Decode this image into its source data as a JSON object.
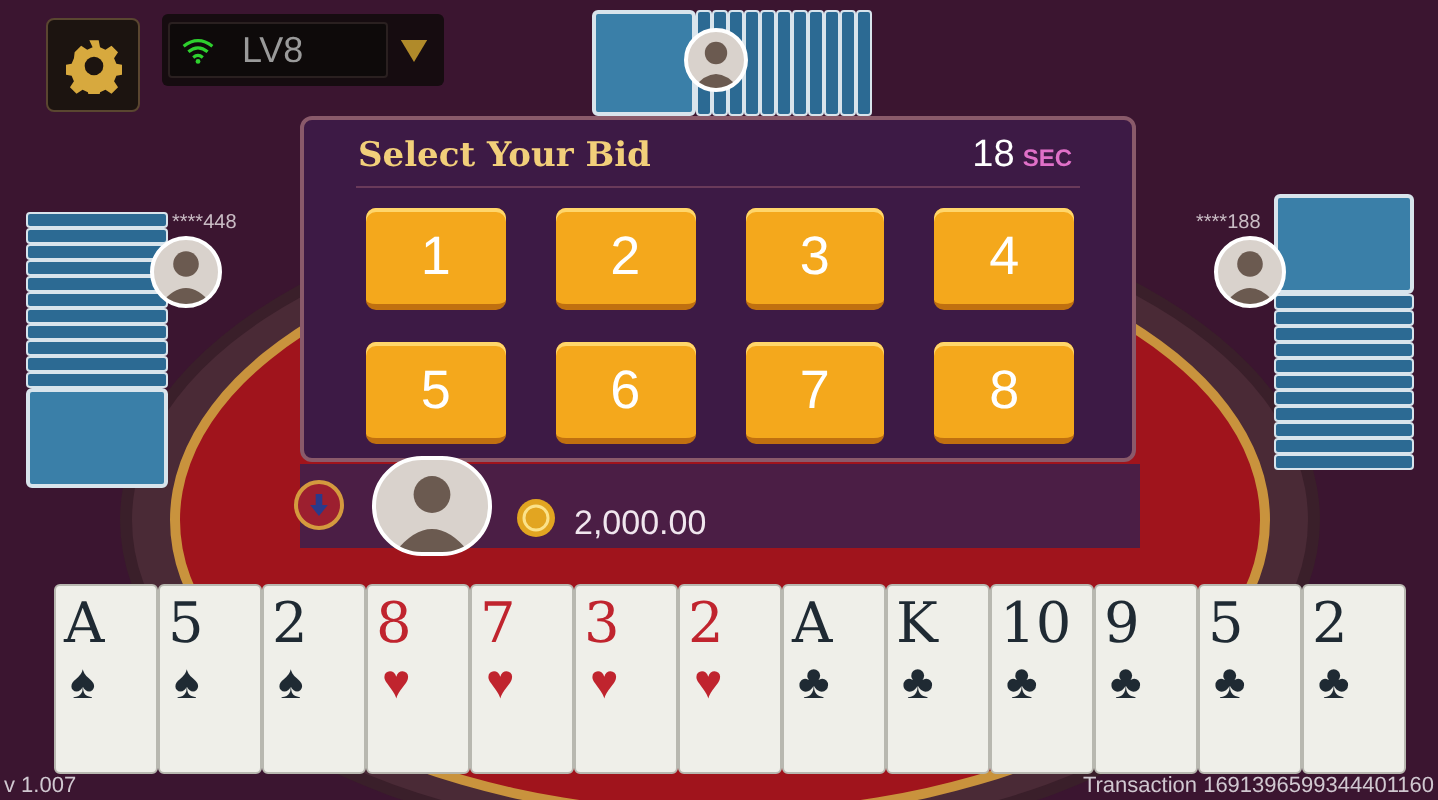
{
  "top_bar": {
    "level": "LV8"
  },
  "opponents": [
    {
      "name": "****448",
      "kind": "left"
    },
    {
      "name": "****188",
      "kind": "right"
    }
  ],
  "bid_dialog": {
    "title": "Select Your Bid",
    "timer": "18",
    "timer_unit": "SEC",
    "options": [
      {
        "label": "1"
      },
      {
        "label": "2"
      },
      {
        "label": "3"
      },
      {
        "label": "4"
      },
      {
        "label": "5"
      },
      {
        "label": "6"
      },
      {
        "label": "7"
      },
      {
        "label": "8"
      }
    ]
  },
  "player": {
    "balance": "2,000.00"
  },
  "hand": [
    {
      "rank": "A",
      "suit": "♠",
      "kind": "spade"
    },
    {
      "rank": "5",
      "suit": "♠",
      "kind": "spade"
    },
    {
      "rank": "2",
      "suit": "♠",
      "kind": "spade"
    },
    {
      "rank": "8",
      "suit": "♥",
      "kind": "heart"
    },
    {
      "rank": "7",
      "suit": "♥",
      "kind": "heart"
    },
    {
      "rank": "3",
      "suit": "♥",
      "kind": "heart"
    },
    {
      "rank": "2",
      "suit": "♥",
      "kind": "heart"
    },
    {
      "rank": "A",
      "suit": "♣",
      "kind": "club"
    },
    {
      "rank": "K",
      "suit": "♣",
      "kind": "club"
    },
    {
      "rank": "10",
      "suit": "♣",
      "kind": "club"
    },
    {
      "rank": "9",
      "suit": "♣",
      "kind": "club"
    },
    {
      "rank": "5",
      "suit": "♣",
      "kind": "club"
    },
    {
      "rank": "2",
      "suit": "♣",
      "kind": "club"
    }
  ],
  "footer": {
    "version": "v 1.007",
    "transaction": "Transaction 1691396599344401160"
  }
}
